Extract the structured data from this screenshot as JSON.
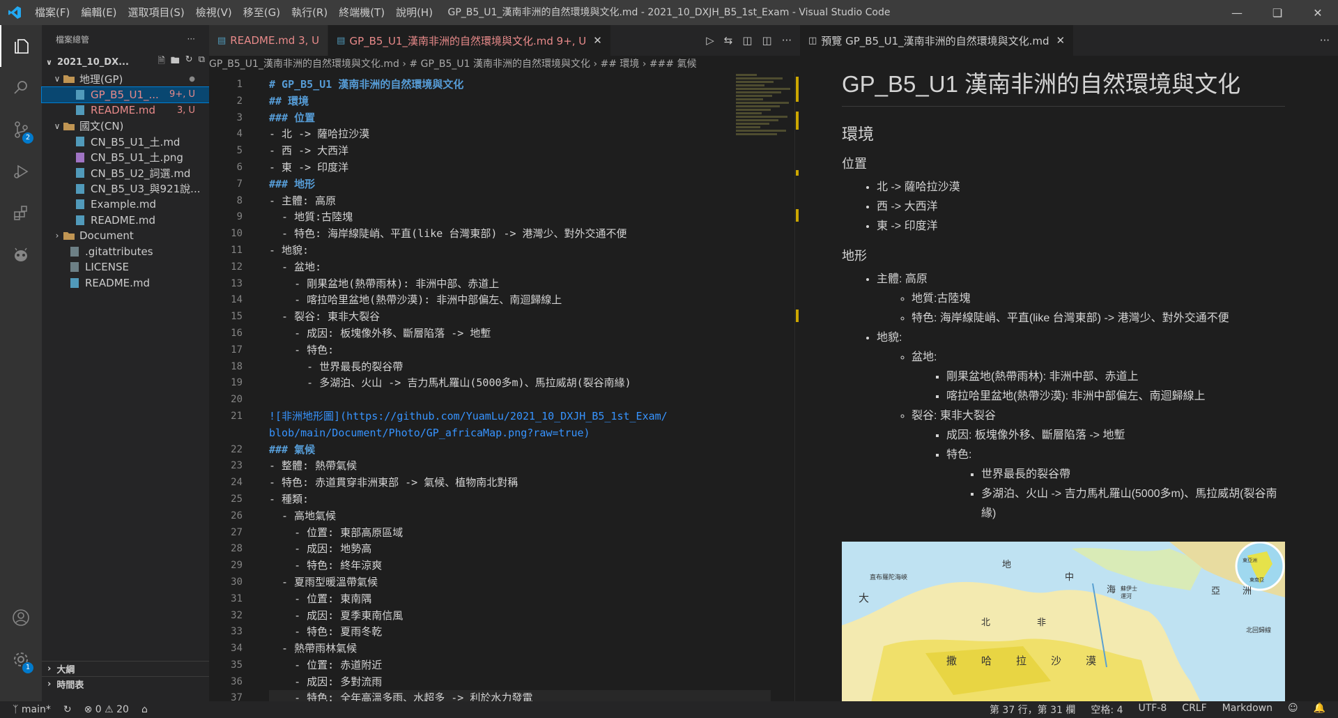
{
  "menu": [
    "檔案(F)",
    "編輯(E)",
    "選取項目(S)",
    "檢視(V)",
    "移至(G)",
    "執行(R)",
    "終端機(T)",
    "說明(H)"
  ],
  "window_title": "GP_B5_U1_漢南非洲的自然環境與文化.md - 2021_10_DXJH_B5_1st_Exam - Visual Studio Code",
  "sidebar": {
    "title": "檔案總管",
    "root": "2021_10_DX...",
    "items": [
      {
        "label": "地理(GP)",
        "status": "●"
      },
      {
        "label": "GP_B5_U1_...",
        "status": "9+, U"
      },
      {
        "label": "README.md",
        "status": "3, U"
      },
      {
        "label": "國文(CN)",
        "status": ""
      },
      {
        "label": "CN_B5_U1_土.md",
        "status": ""
      },
      {
        "label": "CN_B5_U1_土.png",
        "status": ""
      },
      {
        "label": "CN_B5_U2_詞選.md",
        "status": ""
      },
      {
        "label": "CN_B5_U3_與921說...",
        "status": ""
      },
      {
        "label": "Example.md",
        "status": ""
      },
      {
        "label": "README.md",
        "status": ""
      },
      {
        "label": "Document",
        "status": ""
      },
      {
        "label": ".gitattributes",
        "status": ""
      },
      {
        "label": "LICENSE",
        "status": ""
      },
      {
        "label": "README.md",
        "status": ""
      }
    ],
    "outline": "大綱",
    "timeline": "時間表"
  },
  "tabs": {
    "readme": "README.md 3, U",
    "active": "GP_B5_U1_漢南非洲的自然環境與文化.md 9+, U",
    "preview": "預覽 GP_B5_U1_漢南非洲的自然環境與文化.md"
  },
  "breadcrumb": "GP_B5_U1_漢南非洲的自然環境與文化.md  ›  # GP_B5_U1 漢南非洲的自然環境與文化  ›  ## 環境  ›  ### 氣候",
  "editor": {
    "line_numbers": [
      "1",
      "2",
      "3",
      "4",
      "5",
      "6",
      "7",
      "8",
      "9",
      "10",
      "11",
      "12",
      "13",
      "14",
      "15",
      "16",
      "17",
      "18",
      "19",
      "20",
      "21",
      "",
      "22",
      "23",
      "24",
      "25",
      "26",
      "27",
      "28",
      "29",
      "30",
      "31",
      "32",
      "33",
      "34",
      "35",
      "36",
      "37"
    ],
    "lines": [
      "# GP_B5_U1 漢南非洲的自然環境與文化",
      "## 環境",
      "### 位置",
      "- 北 -> 薩哈拉沙漠",
      "- 西 -> 大西洋",
      "- 東 -> 印度洋",
      "### 地形",
      "- 主體: 高原",
      "  - 地質:古陸塊",
      "  - 特色: 海岸線陡峭、平直(like 台灣東部) -> 港灣少、對外交通不便",
      "- 地貌:",
      "  - 盆地:",
      "    - 剛果盆地(熱帶雨林): 非洲中部、赤道上",
      "    - 喀拉哈里盆地(熱帶沙漠): 非洲中部偏左、南迴歸線上",
      "  - 裂谷: 東非大裂谷",
      "    - 成因: 板塊像外移、斷層陷落 -> 地塹",
      "    - 特色:",
      "      - 世界最長的裂谷帶",
      "      - 多湖泊、火山 -> 吉力馬札羅山(5000多m)、馬拉威胡(裂谷南緣)",
      "",
      "![非洲地形圖](https://github.com/YuamLu/2021_10_DXJH_B5_1st_Exam/",
      "blob/main/Document/Photo/GP_africaMap.png?raw=true)",
      "### 氣候",
      "- 整體: 熱帶氣候",
      "- 特色: 赤道貫穿非洲東部 -> 氣候、植物南北對稱",
      "- 種類:",
      "  - 高地氣候",
      "    - 位置: 東部高原區域",
      "    - 成因: 地勢高",
      "    - 特色: 終年涼爽",
      "  - 夏雨型暖溫帶氣候",
      "    - 位置: 東南隅",
      "    - 成因: 夏季東南信風",
      "    - 特色: 夏雨冬乾",
      "  - 熱帶雨林氣候",
      "    - 位置: 赤道附近",
      "    - 成因: 多對流雨",
      "    - 特色: 全年高溫多雨、水超多 -> 利於水力發電"
    ]
  },
  "preview": {
    "h1": "GP_B5_U1 漢南非洲的自然環境與文化",
    "h2": "環境",
    "h3_location": "位置",
    "location": [
      "北 -> 薩哈拉沙漠",
      "西 -> 大西洋",
      "東 -> 印度洋"
    ],
    "h3_terrain": "地形",
    "main": "主體: 高原",
    "geology": "地質:古陸塊",
    "feature": "特色: 海岸線陡峭、平直(like 台灣東部) -> 港灣少、對外交通不便",
    "landform": "地貌:",
    "basin": "盆地:",
    "basin1": "剛果盆地(熱帶雨林): 非洲中部、赤道上",
    "basin2": "喀拉哈里盆地(熱帶沙漠): 非洲中部偏左、南迴歸線上",
    "rift": "裂谷: 東非大裂谷",
    "rift_cause": "成因: 板塊像外移、斷層陷落 -> 地塹",
    "rift_feature": "特色:",
    "rift_f1": "世界最長的裂谷帶",
    "rift_f2": "多湖泊、火山 -> 吉力馬札羅山(5000多m)、馬拉威胡(裂谷南緣)",
    "map_labels": [
      "大",
      "地",
      "中",
      "海",
      "亞",
      "洲",
      "北",
      "非",
      "撒",
      "哈",
      "拉",
      "沙",
      "漠",
      "直布羅陀海峽",
      "蘇伊士運河",
      "北回歸線",
      "東亞洲",
      "東南亞"
    ]
  },
  "statusbar": {
    "branch": "main*",
    "problems": "⊗ 0 ⚠ 20",
    "position": "第 37 行，第 31 欄",
    "spaces": "空格: 4",
    "encoding": "UTF-8",
    "eol": "CRLF",
    "lang": "Markdown"
  },
  "colors": {
    "accent": "#007acc",
    "modified": "#e2c08d",
    "untracked": "#73c991",
    "heading": "#569cd6"
  }
}
